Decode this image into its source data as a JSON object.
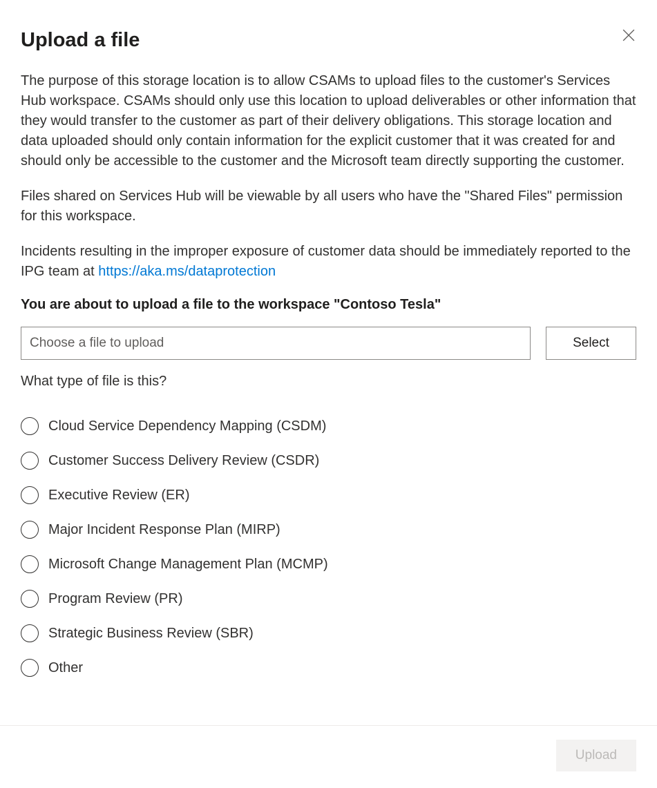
{
  "title": "Upload a file",
  "paragraphs": {
    "p1": "The purpose of this storage location is to allow CSAMs to upload files to the customer's Services Hub workspace. CSAMs should only use this location to upload deliverables or other information that they would transfer to the customer as part of their delivery obligations. This storage location and data uploaded should only contain information for the explicit customer that it was created for and should only be accessible to the customer and the Microsoft team directly supporting the customer.",
    "p2": "Files shared on Services Hub will be viewable by all users who have the \"Shared Files\" permission for this workspace.",
    "p3_prefix": "Incidents resulting in the improper exposure of customer data should be immediately reported to the IPG team at ",
    "p3_link": "https://aka.ms/dataprotection"
  },
  "workspace_heading": "You are about to upload a file to the workspace \"Contoso Tesla\"",
  "file_placeholder": "Choose a file to upload",
  "select_label": "Select",
  "question": "What type of file is this?",
  "file_types": [
    "Cloud Service Dependency Mapping (CSDM)",
    "Customer Success Delivery Review (CSDR)",
    "Executive Review (ER)",
    "Major Incident Response Plan (MIRP)",
    "Microsoft Change Management Plan (MCMP)",
    "Program Review (PR)",
    "Strategic Business Review (SBR)",
    "Other"
  ],
  "upload_label": "Upload"
}
